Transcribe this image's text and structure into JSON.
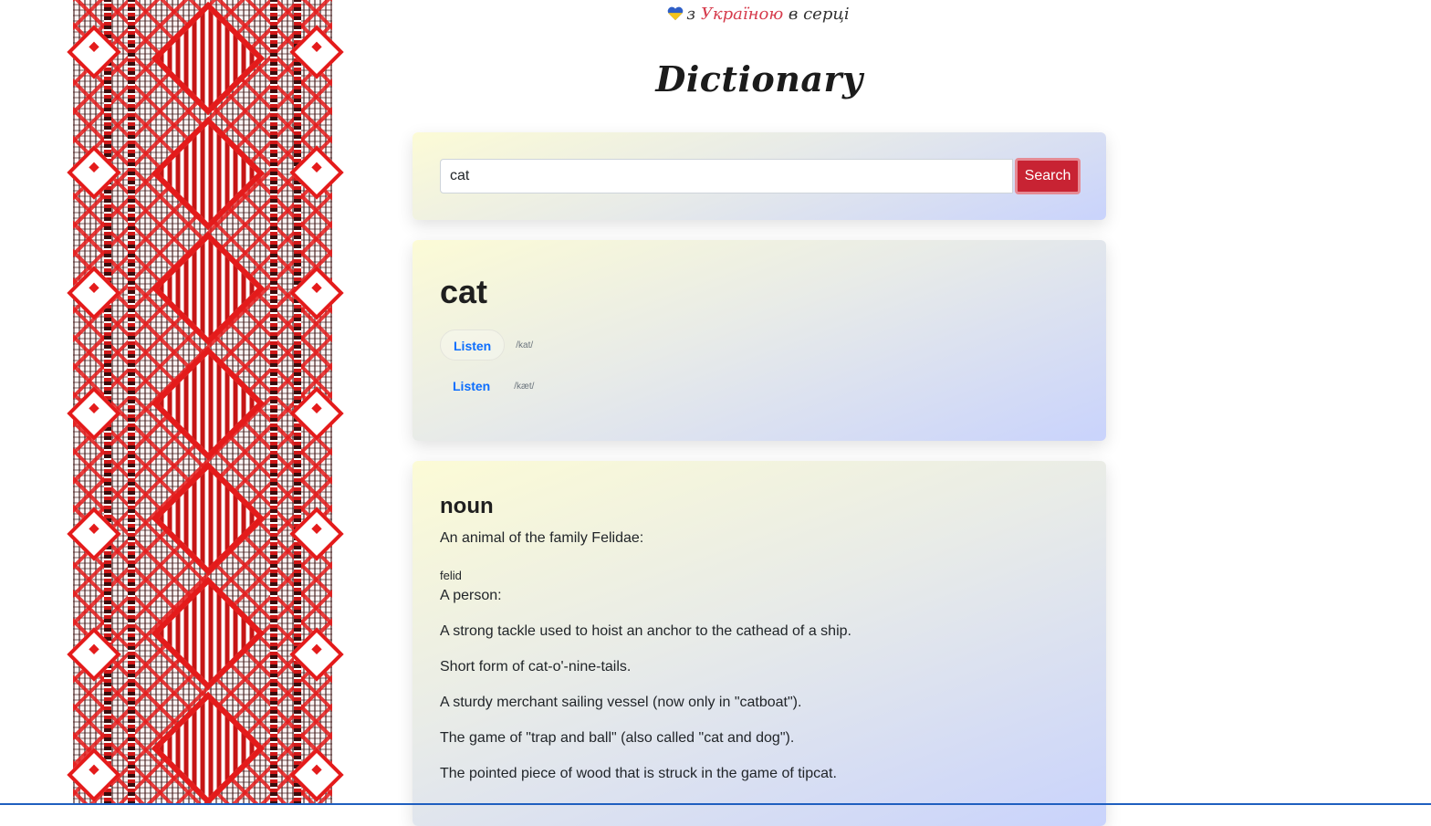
{
  "tagline": {
    "prefix": "з",
    "country": "Україною",
    "suffix": "в серці"
  },
  "header": {
    "title": "Dictionary"
  },
  "search": {
    "value": "cat",
    "button_label": "Search"
  },
  "word_entry": {
    "word": "cat",
    "phonetics": [
      {
        "listen_label": "Listen",
        "text": "/kat/"
      },
      {
        "listen_label": "Listen",
        "text": "/kæt/"
      }
    ]
  },
  "meaning": {
    "part_of_speech": "noun",
    "definitions": [
      {
        "text": "An animal of the family Felidae:",
        "synonym": "felid"
      },
      {
        "text": "A person:"
      },
      {
        "text": "A strong tackle used to hoist an anchor to the cathead of a ship."
      },
      {
        "text": "Short form of cat-o'-nine-tails."
      },
      {
        "text": "A sturdy merchant sailing vessel (now only in \"catboat\")."
      },
      {
        "text": "The game of \"trap and ball\" (also called \"cat and dog\")."
      },
      {
        "text": "The pointed piece of wood that is struck in the game of tipcat."
      }
    ]
  },
  "colors": {
    "accent_red": "#c82333",
    "link_blue": "#0d6efd",
    "tagline_red": "#d63b4c"
  },
  "icons": {
    "tagline_icon": "ukraine-heart-icon"
  }
}
